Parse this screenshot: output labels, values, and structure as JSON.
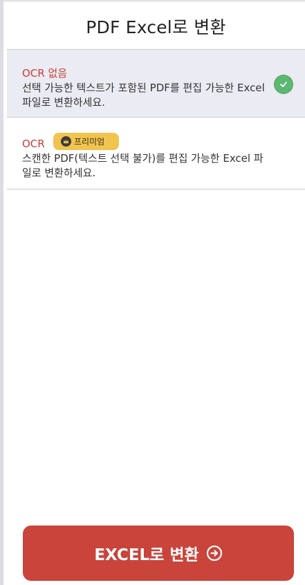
{
  "header": {
    "title": "PDF Excel로 변환"
  },
  "options": [
    {
      "title": "OCR 없음",
      "description": "선택 가능한 텍스트가 포함된 PDF를 편집 가능한 Excel 파일로 변환하세요.",
      "selected": true,
      "icon": "check-icon"
    },
    {
      "title": "OCR",
      "badge": "프리미엄",
      "badge_icon": "crown-icon",
      "description": "스캔한 PDF(텍스트 선택 불가)를 편집 가능한 Excel 파일로 변환하세요.",
      "selected": false
    }
  ],
  "action": {
    "label": "EXCEL로 변환",
    "icon": "arrow-right-circle-icon"
  },
  "colors": {
    "accent": "#c9443a",
    "option_title": "#c63f36",
    "selected_bg": "#ebebf3",
    "check": "#5db672",
    "premium": "#f1c44f"
  }
}
